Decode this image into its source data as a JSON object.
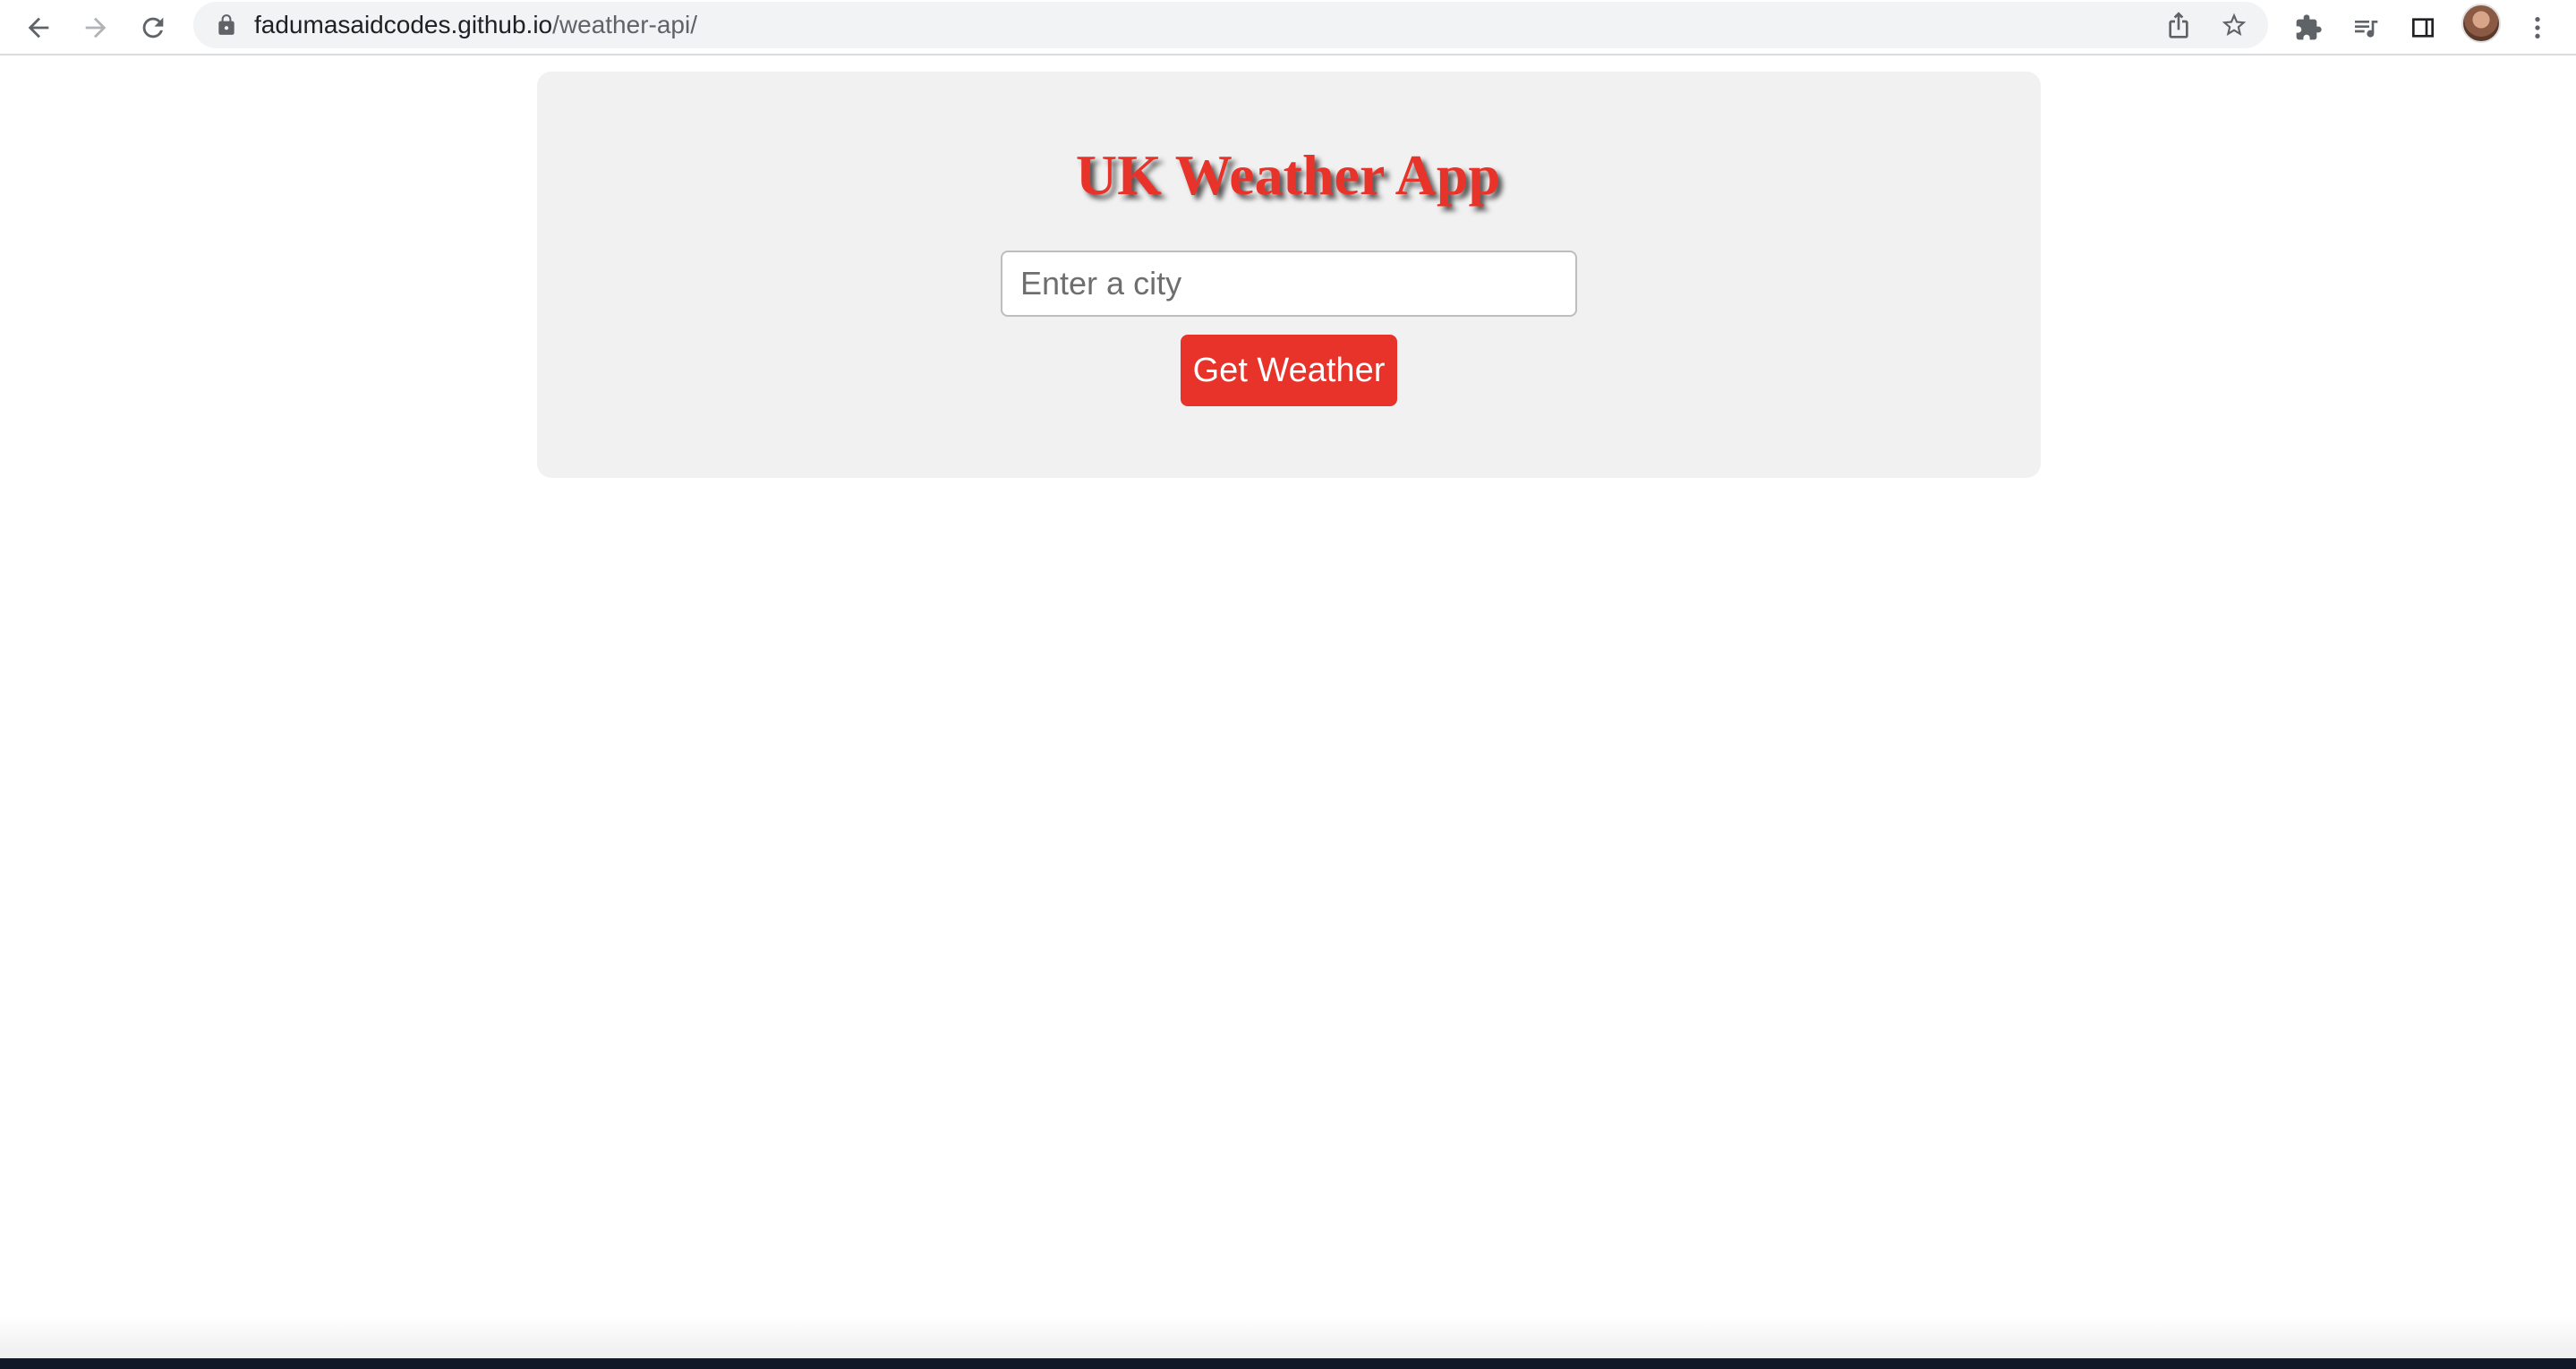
{
  "browser": {
    "url_host": "fadumasaidcodes.github.io",
    "url_path": "/weather-api/",
    "icons": {
      "back": "back-arrow-icon",
      "forward": "forward-arrow-icon",
      "reload": "reload-icon",
      "lock": "lock-icon",
      "share": "share-icon",
      "bookmark": "star-icon",
      "extensions": "puzzle-icon",
      "reading_list": "reading-list-icon",
      "side_panel": "side-panel-icon",
      "profile": "avatar",
      "menu": "kebab-menu-icon"
    }
  },
  "app": {
    "title": "UK Weather App",
    "city_input": {
      "value": "",
      "placeholder": "Enter a city"
    },
    "submit_label": "Get Weather"
  },
  "colors": {
    "accent": "#e8332a",
    "card_background": "#f1f1f1",
    "page_background": "#ffffff"
  }
}
